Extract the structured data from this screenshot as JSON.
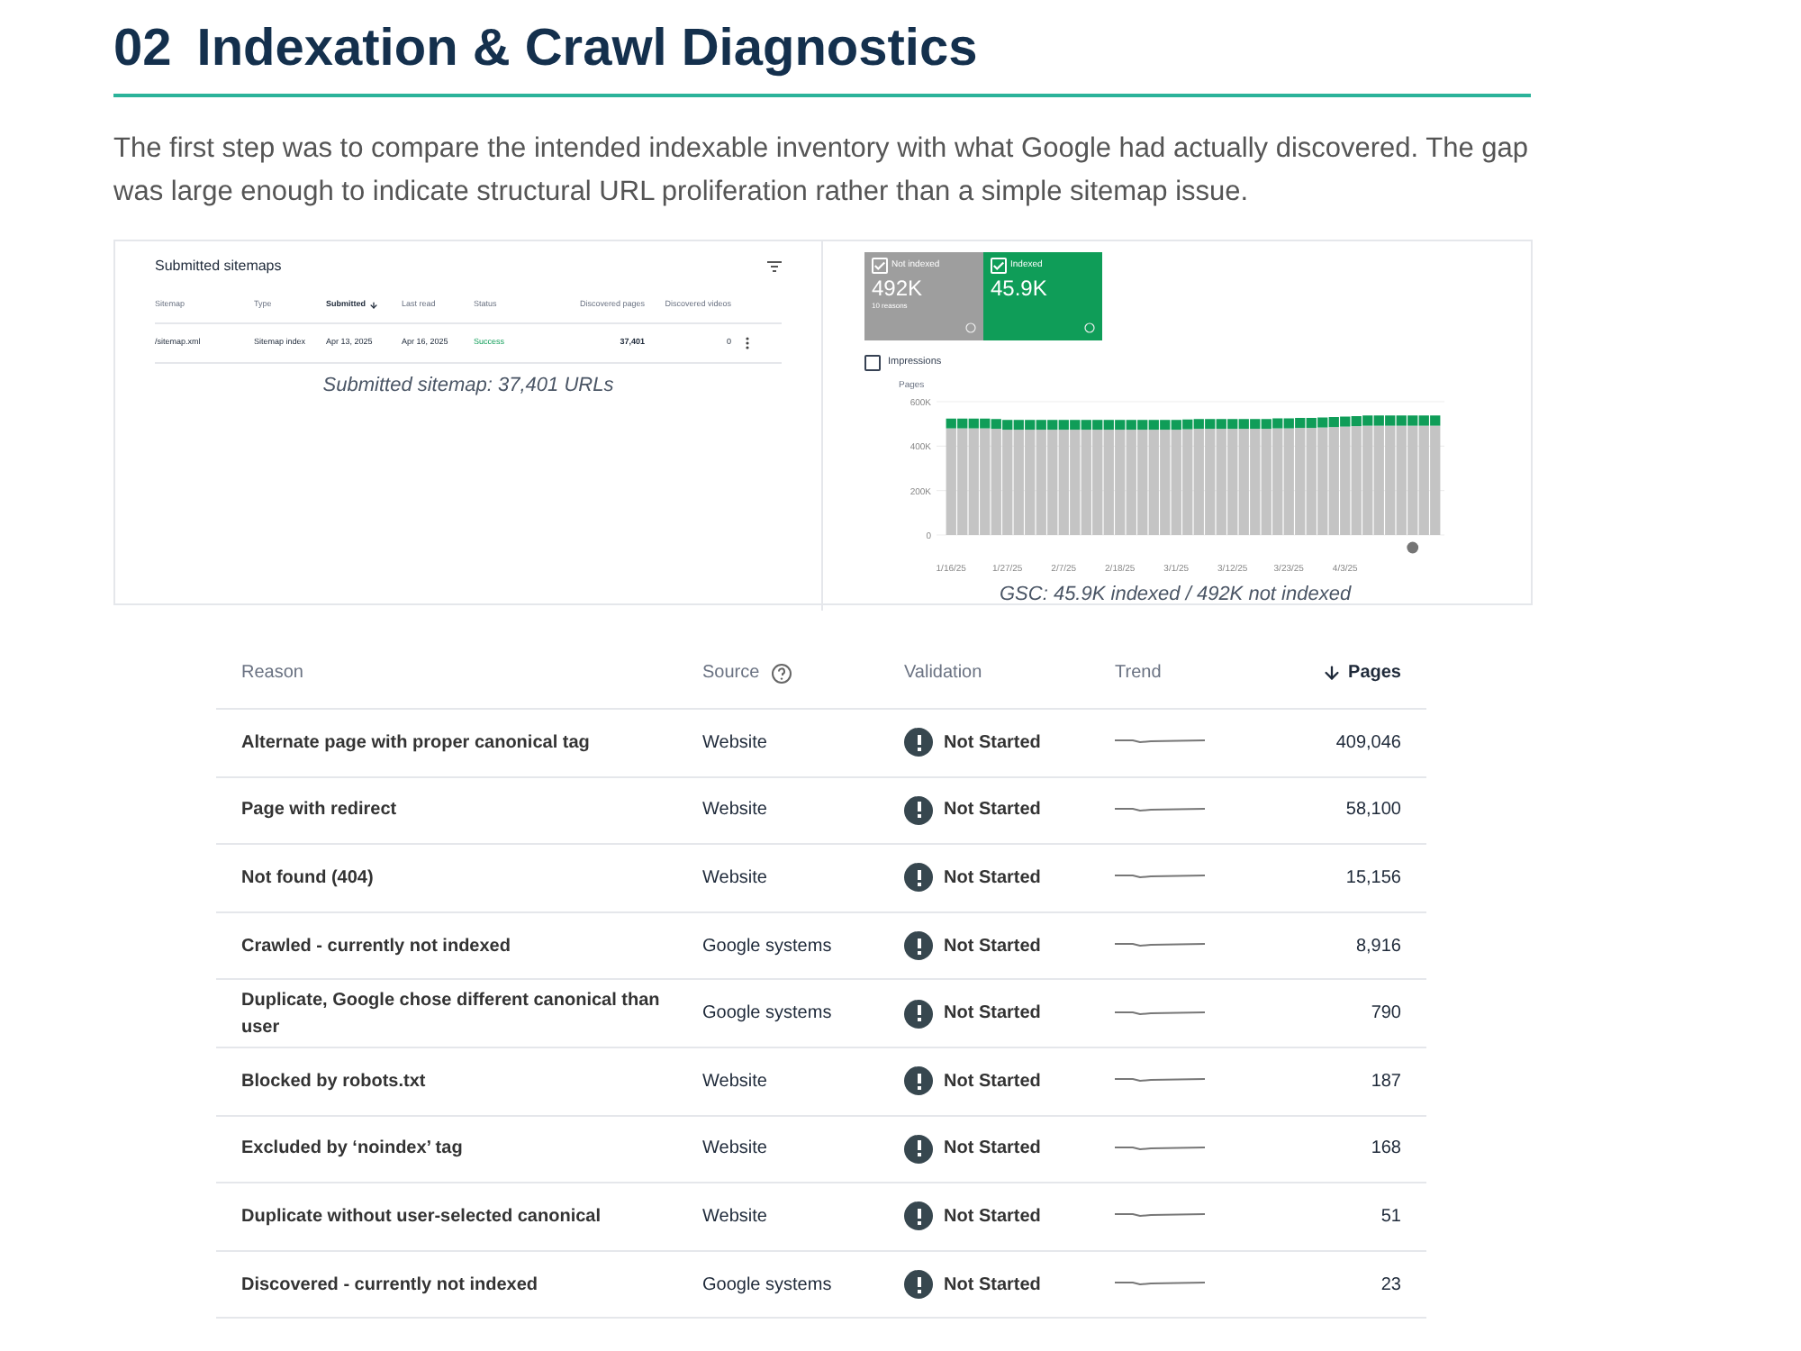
{
  "heading": {
    "number": "02",
    "title": "Indexation & Crawl Diagnostics"
  },
  "intro": "The first step was to compare the intended indexable inventory with what Google had actually discovered. The gap was large enough to indicate structural URL proliferation rather than a simple sitemap issue.",
  "sitemaps_panel": {
    "title": "Submitted sitemaps",
    "columns": [
      {
        "label": "Sitemap",
        "sorted": false
      },
      {
        "label": "Type",
        "sorted": false
      },
      {
        "label": "Submitted",
        "sorted": true
      },
      {
        "label": "Last read",
        "sorted": false
      },
      {
        "label": "Status",
        "sorted": false
      },
      {
        "label": "Discovered pages",
        "sorted": false
      },
      {
        "label": "Discovered videos",
        "sorted": false
      }
    ],
    "rows": [
      {
        "cells": [
          "/sitemap.xml",
          "Sitemap index",
          "Apr 13, 2025",
          "Apr 16, 2025",
          "Success",
          "37,401",
          "0"
        ]
      }
    ],
    "caption": "Submitted sitemap: 37,401 URLs"
  },
  "coverage_panel": {
    "cards": [
      {
        "value": "492K",
        "sub": "10 reasons",
        "checked": true,
        "color": "#9e9e9e"
      },
      {
        "value": "45.9K",
        "checked": true,
        "color": "#0f9d58"
      }
    ],
    "impressions": {
      "label": "Impressions",
      "checked": false
    },
    "chart_data": {
      "type": "bar",
      "stacked": true,
      "ylabel": "Pages",
      "ylim": [
        0,
        600
      ],
      "yticks": [
        {
          "value": 0,
          "label": "0"
        },
        {
          "value": 200,
          "label": "200K"
        },
        {
          "value": 400,
          "label": "400K"
        },
        {
          "value": 600,
          "label": "600K"
        }
      ],
      "categories": [
        "1/16/25",
        null,
        null,
        null,
        null,
        "1/27/25",
        null,
        null,
        null,
        null,
        "2/7/25",
        null,
        null,
        null,
        null,
        "2/18/25",
        null,
        null,
        null,
        null,
        "3/1/25",
        null,
        null,
        null,
        null,
        "3/12/25",
        null,
        null,
        null,
        null,
        "3/23/25",
        null,
        null,
        null,
        null,
        "4/3/25",
        null,
        null,
        null,
        null,
        null,
        null,
        null,
        null
      ],
      "series": [
        {
          "name": "Not indexed",
          "color": "#c4c4c4",
          "values": [
            480,
            480,
            480,
            480,
            478,
            474,
            474,
            474,
            474,
            474,
            474,
            474,
            474,
            474,
            474,
            474,
            474,
            474,
            474,
            474,
            474,
            476,
            478,
            478,
            478,
            478,
            478,
            478,
            478,
            480,
            480,
            482,
            482,
            484,
            486,
            488,
            490,
            492,
            492,
            492,
            492,
            492,
            492,
            492
          ]
        },
        {
          "name": "Indexed",
          "color": "#0f9d58",
          "values": [
            44,
            44,
            44,
            44,
            44,
            44,
            44,
            44,
            44,
            44,
            44,
            44,
            44,
            44,
            44,
            44,
            44,
            44,
            44,
            44,
            44,
            44,
            44,
            44,
            44,
            44,
            44,
            44,
            44,
            45,
            45,
            45,
            45,
            45,
            45,
            45,
            45,
            46,
            46,
            46,
            46,
            46,
            46,
            46
          ]
        }
      ]
    },
    "caption": "GSC: 45.9K indexed / 492K not indexed"
  },
  "reasons_table": {
    "columns": {
      "reason": "Reason",
      "source": "Source",
      "validation": "Validation",
      "trend": "Trend",
      "pages": "Pages"
    },
    "rows": [
      {
        "reason": "Alternate page with proper canonical tag",
        "source": "Website",
        "validation": "Not Started",
        "pages": "409,046"
      },
      {
        "reason": "Page with redirect",
        "source": "Website",
        "validation": "Not Started",
        "pages": "58,100"
      },
      {
        "reason": "Not found (404)",
        "source": "Website",
        "validation": "Not Started",
        "pages": "15,156"
      },
      {
        "reason": "Crawled - currently not indexed",
        "source": "Google systems",
        "validation": "Not Started",
        "pages": "8,916"
      },
      {
        "reason": "Duplicate, Google chose different canonical than user",
        "source": "Google systems",
        "validation": "Not Started",
        "pages": "790"
      },
      {
        "reason": "Blocked by robots.txt",
        "source": "Website",
        "validation": "Not Started",
        "pages": "187"
      },
      {
        "reason": "Excluded by ‘noindex’ tag",
        "source": "Website",
        "validation": "Not Started",
        "pages": "168"
      },
      {
        "reason": "Duplicate without user-selected canonical",
        "source": "Website",
        "validation": "Not Started",
        "pages": "51"
      },
      {
        "reason": "Discovered - currently not indexed",
        "source": "Google systems",
        "validation": "Not Started",
        "pages": "23"
      }
    ]
  }
}
